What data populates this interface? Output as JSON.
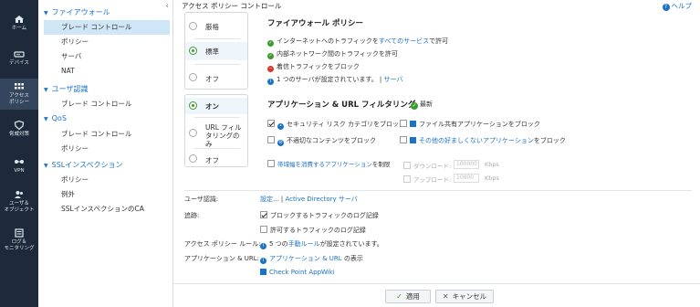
{
  "nav": {
    "items": [
      {
        "label": "ホーム"
      },
      {
        "label": "デバイス"
      },
      {
        "label": "アクセス\nポリシー"
      },
      {
        "label": "脅威対策"
      },
      {
        "label": "VPN"
      },
      {
        "label": "ユーザ＆\nオブジェクト"
      },
      {
        "label": "ログ＆\nモニタリング"
      }
    ]
  },
  "tree": {
    "sections": [
      {
        "title": "ファイアウォール",
        "items": [
          "ブレード コントロール",
          "ポリシー",
          "サーバ",
          "NAT"
        ]
      },
      {
        "title": "ユーザ認識",
        "items": [
          "ブレード コントロール"
        ]
      },
      {
        "title": "QoS",
        "items": [
          "ブレード コントロール",
          "ポリシー"
        ]
      },
      {
        "title": "SSLインスペクション",
        "items": [
          "ポリシー",
          "例外",
          "SSLインスペクションのCA"
        ]
      }
    ]
  },
  "header": {
    "title": "アクセス ポリシー コントロール",
    "help": "ヘルプ"
  },
  "firewall": {
    "options": [
      "厳格",
      "標準",
      "オフ"
    ],
    "selected": "標準",
    "heading": "ファイアウォール ポリシー",
    "lines": {
      "l1_pre": "インターネットへのトラフィックを",
      "l1_link": "すべてのサービス",
      "l1_post": "で許可",
      "l2": "内部ネットワーク間のトラフィックを許可",
      "l3": "着信トラフィックをブロック",
      "l4_pre": "1 つのサーバが設定されています。 | ",
      "l4_link": "サーバ"
    }
  },
  "app": {
    "options": [
      "オン",
      "URL フィルタリングのみ",
      "オフ"
    ],
    "selected": "オン",
    "heading": "アプリケーション & URL フィルタリング",
    "status": "最新",
    "cb1": "セキュリティ リスク カテゴリをブロック",
    "cb2": "ファイル共有アプリケーションをブロック",
    "cb3": "不適切なコンテンツをブロック",
    "cb4_link": "その他の好ましくないアプリケーション",
    "cb4_post": "をブロック",
    "cb5_link": "帯域幅を消費するアプリケーション",
    "cb5_post": "を制限",
    "download_label": "ダウンロード:",
    "download_value": "100000",
    "upload_label": "アップロード:",
    "upload_value": "10000",
    "unit": "Kbps"
  },
  "settings": {
    "user_label": "ユーザ認識:",
    "user_link1": "設定...",
    "user_sep": " | ",
    "user_link2": "Active Directory サーバ",
    "track_label": "追跡:",
    "track_cb1": "ブロックするトラフィックのログ記録",
    "track_cb2": "許可するトラフィックのログ記録",
    "rule_label": "アクセス ポリシー ルール:",
    "rule_pre": "5 つの",
    "rule_link": "手動ルール",
    "rule_post": "が設定されています。",
    "appurl_label": "アプリケーション & URL:",
    "appurl_link": "アプリケーション & URL",
    "appurl_post": " の表示",
    "appwiki": "Check Point AppWiki"
  },
  "footer": {
    "apply": "適用",
    "cancel": "キャンセル"
  }
}
